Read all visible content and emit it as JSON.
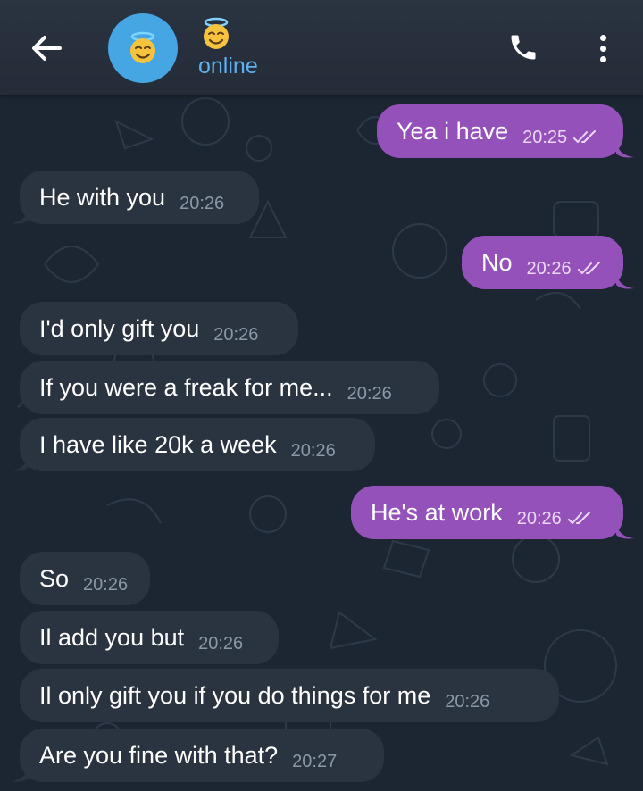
{
  "header": {
    "back_icon": "arrow-left-icon",
    "avatar_icon": "smiling-face-with-halo-icon",
    "title_icon": "smiling-face-with-halo-icon",
    "status": "online",
    "call_icon": "phone-icon",
    "menu_icon": "more-vert-icon"
  },
  "messages": [
    {
      "dir": "out",
      "text": "Yea i have",
      "time": "20:25",
      "read": true
    },
    {
      "dir": "in",
      "text": "He with you",
      "time": "20:26"
    },
    {
      "dir": "out",
      "text": "No",
      "time": "20:26",
      "read": true
    },
    {
      "dir": "in",
      "text": "I'd only gift you",
      "time": "20:26"
    },
    {
      "dir": "in",
      "text": "If you were a freak for me...",
      "time": "20:26"
    },
    {
      "dir": "in",
      "text": "I have like 20k a week",
      "time": "20:26"
    },
    {
      "dir": "out",
      "text": "He's at work",
      "time": "20:26",
      "read": true
    },
    {
      "dir": "in",
      "text": "So",
      "time": "20:26"
    },
    {
      "dir": "in",
      "text": "Il add you but",
      "time": "20:26"
    },
    {
      "dir": "in",
      "text": "Il only gift you if you do things for me",
      "time": "20:26"
    },
    {
      "dir": "in",
      "text": "Are you fine with that?",
      "time": "20:27"
    }
  ],
  "colors": {
    "incoming_bubble": "#2a3441",
    "outgoing_bubble": "#9451ba",
    "status_online": "#5fb0ee",
    "avatar_bg": "#46a5e3"
  }
}
